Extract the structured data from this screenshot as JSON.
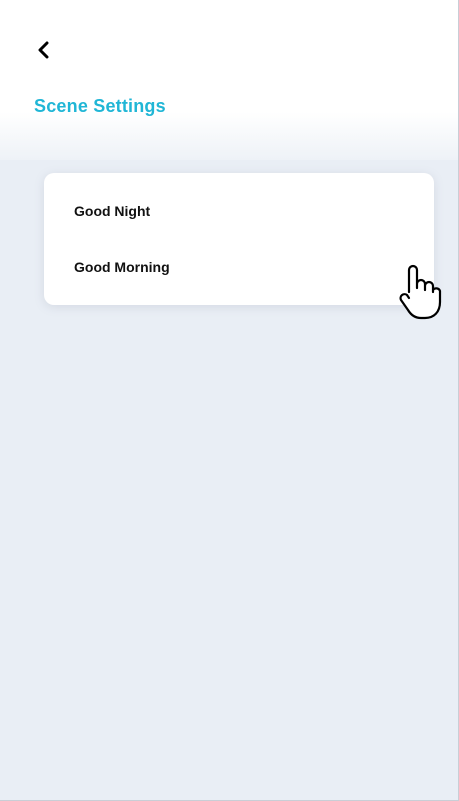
{
  "header": {
    "back_icon": "chevron-left-icon",
    "title": "Scene Settings",
    "title_color": "#20b6d6"
  },
  "scenes": {
    "items": [
      {
        "label": "Good Night"
      },
      {
        "label": "Good Morning"
      }
    ]
  },
  "cursor": {
    "icon": "hand-pointer-icon"
  }
}
